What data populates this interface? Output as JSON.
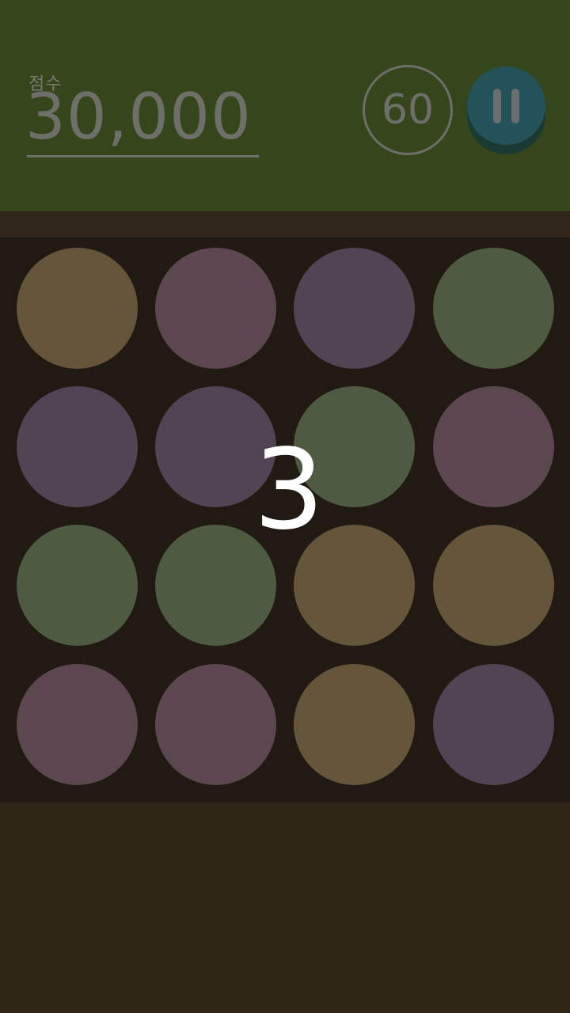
{
  "hud": {
    "score_label": "점수",
    "score_value": "30,000",
    "timer_value": "60"
  },
  "countdown": "3",
  "colors": {
    "header_bg": "#35461d",
    "board_bg": "#211a12",
    "tan": "#64553b",
    "mauve": "#5c4750",
    "purple": "#504455",
    "green": "#4f5b41",
    "pause_button": "#24525a"
  },
  "board": {
    "rows": [
      [
        "tan",
        "mauve",
        "purple",
        "green"
      ],
      [
        "purple",
        "purple",
        "green",
        "mauve"
      ],
      [
        "green",
        "green",
        "tan",
        "tan"
      ],
      [
        "mauve",
        "mauve",
        "tan",
        "purple"
      ]
    ]
  },
  "icons": {
    "pause": "pause-icon"
  }
}
